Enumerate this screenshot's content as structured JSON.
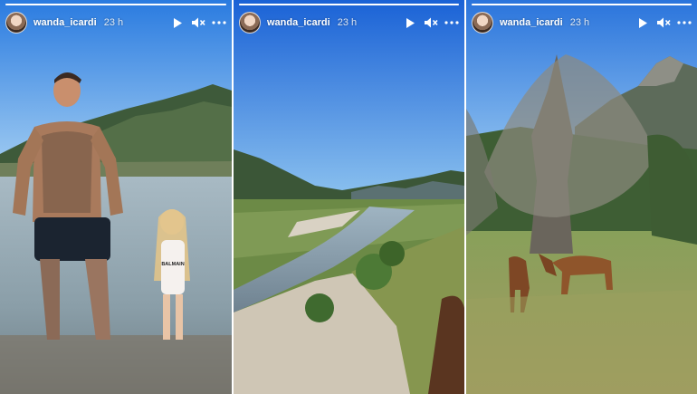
{
  "stories": [
    {
      "username": "wanda_icardi",
      "time": "23 h",
      "swimsuit_text": "BALMAIN",
      "progress": 1.0,
      "icons": [
        "play-icon",
        "mute-icon",
        "more-icon"
      ]
    },
    {
      "username": "wanda_icardi",
      "time": "23 h",
      "progress": 1.0,
      "icons": [
        "play-icon",
        "mute-icon",
        "more-icon"
      ]
    },
    {
      "username": "wanda_icardi",
      "time": "23 h",
      "progress": 1.0,
      "icons": [
        "play-icon",
        "mute-icon",
        "more-icon"
      ]
    }
  ],
  "colors": {
    "sky_top": "#1f6fe0",
    "sky_bottom": "#8fc6f2",
    "mountain": "#3f5d3b",
    "water": "#9fb6c3",
    "grass": "#7f9a52",
    "horse": "#8a4e28"
  }
}
